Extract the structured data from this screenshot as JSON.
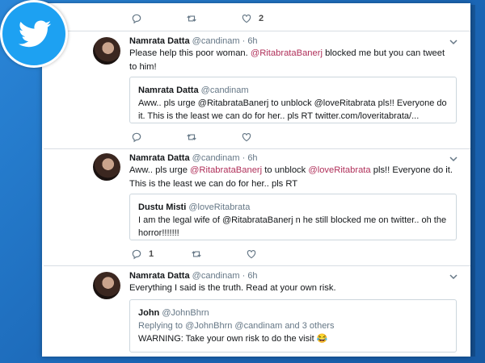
{
  "top_actions": {
    "like_count": "2"
  },
  "tweets": [
    {
      "name": "Namrata Datta",
      "handle": "@candinam",
      "time": "· 6h",
      "text_a": "Please help this poor woman.",
      "mention_1": "@RitabrataBanerj",
      "text_b": "blocked me but you can tweet to him!",
      "quote": {
        "name": "Namrata Datta",
        "handle": "@candinam",
        "text": "Aww.. pls urge @RitabrataBanerj to unblock @loveRitabrata pls!! Everyone do it. This is the least we can do for her.. pls RT twitter.com/loveritabrata/..."
      }
    },
    {
      "name": "Namrata Datta",
      "handle": "@candinam",
      "time": "· 6h",
      "text_a": "Aww.. pls urge",
      "mention_1": "@RitabrataBanerj",
      "text_b": "to unblock",
      "mention_2": "@loveRitabrata",
      "text_c": "pls!! Everyone do it. This is the least we can do for her.. pls RT",
      "quote": {
        "name": "Dustu Misti",
        "handle": "@loveRitabrata",
        "text": "I am the legal wife of @RitabrataBanerj n he still blocked me on twitter.. oh the horror!!!!!!!"
      },
      "reply_count": "1"
    },
    {
      "name": "Namrata Datta",
      "handle": "@candinam",
      "time": "· 6h",
      "text": "Everything I said is the truth. Read at your own risk.",
      "quote": {
        "name": "John",
        "handle": "@JohnBhrn",
        "replying": "Replying to @JohnBhrn @candinam and 3 others",
        "text": "WARNING: Take your own risk to do the visit 😂"
      }
    }
  ],
  "icons": {
    "reply": "reply-icon",
    "retweet": "retweet-icon",
    "like": "heart-icon",
    "more": "chevron-down-icon",
    "logo": "twitter-bird-icon"
  },
  "colors": {
    "mention": "#b0305a",
    "background": "#1e74c6",
    "twitter_blue": "#1da1f2"
  }
}
